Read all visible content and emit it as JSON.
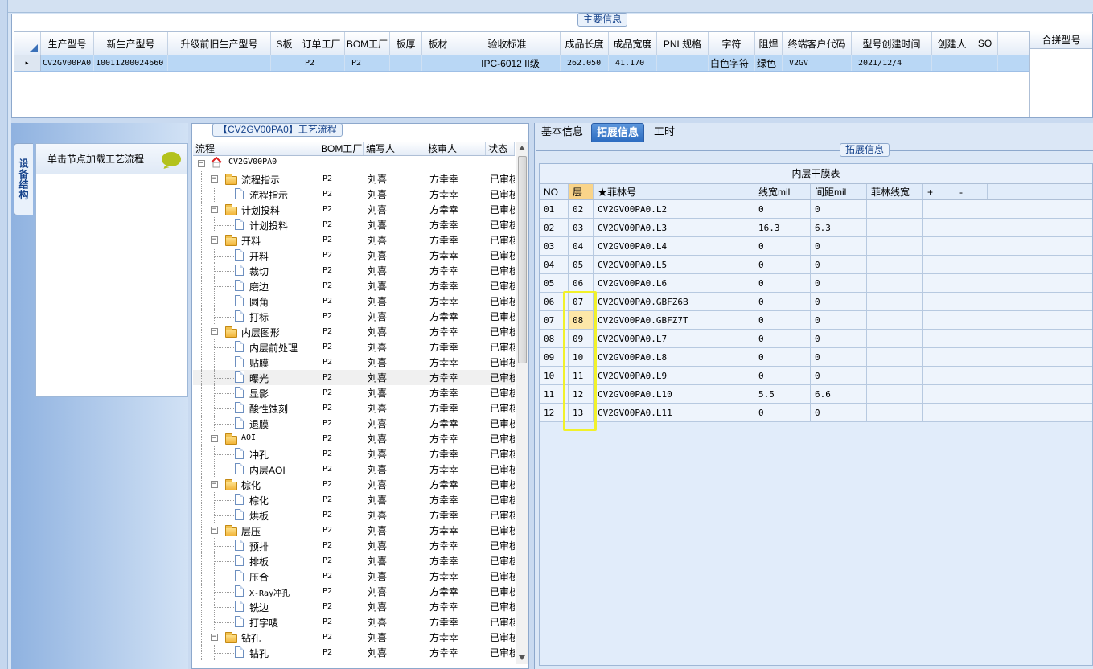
{
  "main_info": {
    "group_title": "主要信息",
    "columns": [
      "",
      "生产型号",
      "新生产型号",
      "升级前旧生产型号",
      "S板",
      "订单工厂",
      "BOM工厂",
      "板厚",
      "板材",
      "验收标准",
      "成品长度",
      "成品宽度",
      "PNL规格",
      "字符",
      "阻焊",
      "终端客户代码",
      "型号创建时间",
      "创建人",
      "SO"
    ],
    "row": {
      "selector": "▸",
      "prod_model": "CV2GV00PA0",
      "new_prod_model": "10011200024660",
      "old_prod_model": "",
      "s_board": "",
      "order_factory": "P2",
      "bom_factory": "P2",
      "thickness": "",
      "material": "",
      "standard": "IPC-6012 II级",
      "length": "262.050",
      "width": "41.170",
      "pnl_spec": "",
      "legend": "白色字符",
      "solder_mask": "绿色",
      "customer_code": "V2GV",
      "created_time": "2021/12/4",
      "creator": "",
      "so": ""
    },
    "merge_header": "合拼型号"
  },
  "left_tab": {
    "label": "设备结构"
  },
  "node_panel": {
    "header": "单击节点加载工艺流程"
  },
  "process": {
    "title": "【CV2GV00PA0】工艺流程",
    "columns": [
      "流程",
      "BOM工厂",
      "编写人",
      "核审人",
      "状态"
    ],
    "rows": [
      {
        "level": 0,
        "type": "root",
        "name": "CV2GV00PA0",
        "bom": "",
        "writer": "",
        "checker": "",
        "status": ""
      },
      {
        "level": 1,
        "type": "folder",
        "name": "流程指示",
        "bom": "P2",
        "writer": "刘喜",
        "checker": "方幸幸",
        "status": "已审核"
      },
      {
        "level": 2,
        "type": "doc",
        "name": "流程指示",
        "bom": "P2",
        "writer": "刘喜",
        "checker": "方幸幸",
        "status": "已审核"
      },
      {
        "level": 1,
        "type": "folder",
        "name": "计划投料",
        "bom": "P2",
        "writer": "刘喜",
        "checker": "方幸幸",
        "status": "已审核"
      },
      {
        "level": 2,
        "type": "doc",
        "name": "计划投料",
        "bom": "P2",
        "writer": "刘喜",
        "checker": "方幸幸",
        "status": "已审核"
      },
      {
        "level": 1,
        "type": "folder",
        "name": "开料",
        "bom": "P2",
        "writer": "刘喜",
        "checker": "方幸幸",
        "status": "已审核"
      },
      {
        "level": 2,
        "type": "doc",
        "name": "开料",
        "bom": "P2",
        "writer": "刘喜",
        "checker": "方幸幸",
        "status": "已审核"
      },
      {
        "level": 2,
        "type": "doc",
        "name": "裁切",
        "bom": "P2",
        "writer": "刘喜",
        "checker": "方幸幸",
        "status": "已审核"
      },
      {
        "level": 2,
        "type": "doc",
        "name": "磨边",
        "bom": "P2",
        "writer": "刘喜",
        "checker": "方幸幸",
        "status": "已审核"
      },
      {
        "level": 2,
        "type": "doc",
        "name": "圆角",
        "bom": "P2",
        "writer": "刘喜",
        "checker": "方幸幸",
        "status": "已审核"
      },
      {
        "level": 2,
        "type": "doc",
        "name": "打标",
        "bom": "P2",
        "writer": "刘喜",
        "checker": "方幸幸",
        "status": "已审核"
      },
      {
        "level": 1,
        "type": "folder",
        "name": "内层图形",
        "bom": "P2",
        "writer": "刘喜",
        "checker": "方幸幸",
        "status": "已审核"
      },
      {
        "level": 2,
        "type": "doc",
        "name": "内层前处理",
        "bom": "P2",
        "writer": "刘喜",
        "checker": "方幸幸",
        "status": "已审核"
      },
      {
        "level": 2,
        "type": "doc",
        "name": "贴膜",
        "bom": "P2",
        "writer": "刘喜",
        "checker": "方幸幸",
        "status": "已审核"
      },
      {
        "level": 2,
        "type": "doc",
        "name": "曝光",
        "bom": "P2",
        "writer": "刘喜",
        "checker": "方幸幸",
        "status": "已审核",
        "selected": true
      },
      {
        "level": 2,
        "type": "doc",
        "name": "显影",
        "bom": "P2",
        "writer": "刘喜",
        "checker": "方幸幸",
        "status": "已审核"
      },
      {
        "level": 2,
        "type": "doc",
        "name": "酸性蚀刻",
        "bom": "P2",
        "writer": "刘喜",
        "checker": "方幸幸",
        "status": "已审核"
      },
      {
        "level": 2,
        "type": "doc",
        "name": "退膜",
        "bom": "P2",
        "writer": "刘喜",
        "checker": "方幸幸",
        "status": "已审核"
      },
      {
        "level": 1,
        "type": "folder",
        "name": "AOI",
        "bom": "P2",
        "writer": "刘喜",
        "checker": "方幸幸",
        "status": "已审核"
      },
      {
        "level": 2,
        "type": "doc",
        "name": "冲孔",
        "bom": "P2",
        "writer": "刘喜",
        "checker": "方幸幸",
        "status": "已审核"
      },
      {
        "level": 2,
        "type": "doc",
        "name": "内层AOI",
        "bom": "P2",
        "writer": "刘喜",
        "checker": "方幸幸",
        "status": "已审核"
      },
      {
        "level": 1,
        "type": "folder",
        "name": "棕化",
        "bom": "P2",
        "writer": "刘喜",
        "checker": "方幸幸",
        "status": "已审核"
      },
      {
        "level": 2,
        "type": "doc",
        "name": "棕化",
        "bom": "P2",
        "writer": "刘喜",
        "checker": "方幸幸",
        "status": "已审核"
      },
      {
        "level": 2,
        "type": "doc",
        "name": "烘板",
        "bom": "P2",
        "writer": "刘喜",
        "checker": "方幸幸",
        "status": "已审核"
      },
      {
        "level": 1,
        "type": "folder",
        "name": "层压",
        "bom": "P2",
        "writer": "刘喜",
        "checker": "方幸幸",
        "status": "已审核"
      },
      {
        "level": 2,
        "type": "doc",
        "name": "预排",
        "bom": "P2",
        "writer": "刘喜",
        "checker": "方幸幸",
        "status": "已审核"
      },
      {
        "level": 2,
        "type": "doc",
        "name": "排板",
        "bom": "P2",
        "writer": "刘喜",
        "checker": "方幸幸",
        "status": "已审核"
      },
      {
        "level": 2,
        "type": "doc",
        "name": "压合",
        "bom": "P2",
        "writer": "刘喜",
        "checker": "方幸幸",
        "status": "已审核"
      },
      {
        "level": 2,
        "type": "doc",
        "name": "X-Ray冲孔",
        "bom": "P2",
        "writer": "刘喜",
        "checker": "方幸幸",
        "status": "已审核"
      },
      {
        "level": 2,
        "type": "doc",
        "name": "铣边",
        "bom": "P2",
        "writer": "刘喜",
        "checker": "方幸幸",
        "status": "已审核"
      },
      {
        "level": 2,
        "type": "doc",
        "name": "打字唛",
        "bom": "P2",
        "writer": "刘喜",
        "checker": "方幸幸",
        "status": "已审核"
      },
      {
        "level": 1,
        "type": "folder",
        "name": "钻孔",
        "bom": "P2",
        "writer": "刘喜",
        "checker": "方幸幸",
        "status": "已审核"
      },
      {
        "level": 2,
        "type": "doc",
        "name": "钻孔",
        "bom": "P2",
        "writer": "刘喜",
        "checker": "方幸幸",
        "status": "已审核"
      }
    ]
  },
  "tabs": [
    {
      "label": "基本信息",
      "active": false
    },
    {
      "label": "拓展信息",
      "active": true
    },
    {
      "label": "工时",
      "active": false
    }
  ],
  "ext_info": {
    "group_title": "拓展信息",
    "table_title": "内层干膜表",
    "columns": [
      "NO",
      "层",
      "★菲林号",
      "线宽mil",
      "间距mil",
      "菲林线宽",
      "+",
      "-"
    ],
    "rows": [
      {
        "no": "01",
        "layer": "02",
        "film": "CV2GV00PA0.L2",
        "lw": "0",
        "sp": "0",
        "flw": ""
      },
      {
        "no": "02",
        "layer": "03",
        "film": "CV2GV00PA0.L3",
        "lw": "16.3",
        "sp": "6.3",
        "flw": ""
      },
      {
        "no": "03",
        "layer": "04",
        "film": "CV2GV00PA0.L4",
        "lw": "0",
        "sp": "0",
        "flw": ""
      },
      {
        "no": "04",
        "layer": "05",
        "film": "CV2GV00PA0.L5",
        "lw": "0",
        "sp": "0",
        "flw": ""
      },
      {
        "no": "05",
        "layer": "06",
        "film": "CV2GV00PA0.L6",
        "lw": "0",
        "sp": "0",
        "flw": ""
      },
      {
        "no": "06",
        "layer": "07",
        "film": "CV2GV00PA0.GBFZ6B",
        "lw": "0",
        "sp": "0",
        "flw": ""
      },
      {
        "no": "07",
        "layer": "08",
        "film": "CV2GV00PA0.GBFZ7T",
        "lw": "0",
        "sp": "0",
        "flw": "",
        "highlight": true
      },
      {
        "no": "08",
        "layer": "09",
        "film": "CV2GV00PA0.L7",
        "lw": "0",
        "sp": "0",
        "flw": ""
      },
      {
        "no": "09",
        "layer": "10",
        "film": "CV2GV00PA0.L8",
        "lw": "0",
        "sp": "0",
        "flw": ""
      },
      {
        "no": "10",
        "layer": "11",
        "film": "CV2GV00PA0.L9",
        "lw": "0",
        "sp": "0",
        "flw": ""
      },
      {
        "no": "11",
        "layer": "12",
        "film": "CV2GV00PA0.L10",
        "lw": "5.5",
        "sp": "6.6",
        "flw": ""
      },
      {
        "no": "12",
        "layer": "13",
        "film": "CV2GV00PA0.L11",
        "lw": "0",
        "sp": "0",
        "flw": ""
      }
    ]
  },
  "colors": {
    "accent": "#2c6cc1",
    "selection_row": "#b9d7f5",
    "highlight_box": "#f1f12a",
    "highlight_cell": "#fde7a8"
  }
}
